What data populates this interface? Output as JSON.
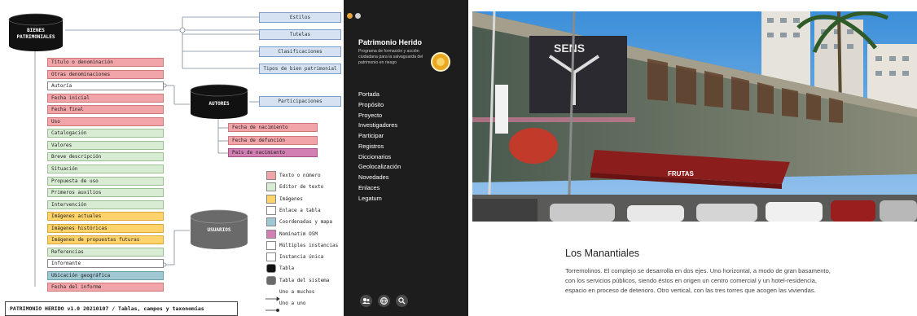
{
  "diagram": {
    "db_bienes": "BIENES PATRIMONIALES",
    "db_autores": "AUTORES",
    "db_usuarios": "USUARIOS",
    "taxonomies": [
      "Estilos",
      "Tutelas",
      "Clasificaciones",
      "Tipos de bien patrimonial"
    ],
    "participaciones": "Participaciones",
    "fields": [
      {
        "label": "Título o denominación",
        "color": "red"
      },
      {
        "label": "Otras denominaciones",
        "color": "red"
      },
      {
        "label": "Autoría",
        "color": "white"
      },
      {
        "label": "Fecha inicial",
        "color": "red"
      },
      {
        "label": "Fecha final",
        "color": "red"
      },
      {
        "label": "Uso",
        "color": "red"
      },
      {
        "label": "Catalogación",
        "color": "green"
      },
      {
        "label": "Valores",
        "color": "green"
      },
      {
        "label": "Breve descripción",
        "color": "green"
      },
      {
        "label": "Situación",
        "color": "green"
      },
      {
        "label": "Propuesta de uso",
        "color": "green"
      },
      {
        "label": "Primeros auxilios",
        "color": "green"
      },
      {
        "label": "Intervención",
        "color": "green"
      },
      {
        "label": "Imágenes actuales",
        "color": "yellow"
      },
      {
        "label": "Imágenes históricas",
        "color": "yellow"
      },
      {
        "label": "Imágenes de propuestas futuras",
        "color": "yellow"
      },
      {
        "label": "Referencias",
        "color": "green"
      },
      {
        "label": "Informante",
        "color": "white"
      },
      {
        "label": "Ubicación geográfica",
        "color": "teal"
      },
      {
        "label": "Fecha del informe",
        "color": "red"
      }
    ],
    "author_fields": [
      {
        "label": "Fecha de nacimiento",
        "color": "red"
      },
      {
        "label": "Fecha de defunción",
        "color": "red"
      },
      {
        "label": "País de nacimiento",
        "color": "purple"
      }
    ],
    "legend": [
      {
        "label": "Texto o número",
        "swatch": "red"
      },
      {
        "label": "Editor de texto",
        "swatch": "green"
      },
      {
        "label": "Imágenes",
        "swatch": "yellow"
      },
      {
        "label": "Enlace a tabla",
        "swatch": "white"
      },
      {
        "label": "Coordenadas y mapa",
        "swatch": "teal"
      },
      {
        "label": "Nominatim OSM",
        "swatch": "purple"
      },
      {
        "label": "Múltiples instancias",
        "swatch": "white"
      },
      {
        "label": "Instancia única",
        "swatch": "white"
      },
      {
        "label": "Tabla",
        "swatch": "black"
      },
      {
        "label": "Tabla del sistema",
        "swatch": "gray"
      },
      {
        "label": "Uno a muchos",
        "swatch": "arrow-many"
      },
      {
        "label": "Uno a uno",
        "swatch": "arrow-one"
      }
    ],
    "footer": "PATRIMONIO HERIDO v1.0 20210107 / Tablas, campos y taxonomías"
  },
  "sidebar": {
    "dot_colors": [
      "#e8a53a",
      "#cfcfcf"
    ],
    "title": "Patrimonio Herido",
    "description": "Programa de formación y acción ciudadana para la salvaguarda del patrimonio en riesgo",
    "menu": [
      "Portada",
      "Propósito",
      "Proyecto",
      "Investigadores",
      "Participar",
      "Registros",
      "Diccionarios",
      "Geolocalización",
      "Novedades",
      "Enlaces",
      "Legatum"
    ],
    "tools": [
      "user-icon",
      "globe-icon",
      "search-icon"
    ]
  },
  "article": {
    "photo_signs": {
      "store": "FRUTAS",
      "logo": "SENS"
    },
    "title": "Los Manantiales",
    "body": "Torremolinos. El complejo se desarrolla en dos ejes. Uno horizontal, a modo de gran basamento, con los servicios públicos, siendo éstos en origen un centro comercial y un hotel-residencia, espacio en proceso de deterioro. Otro vertical, con las tres torres que acogen las viviendas."
  }
}
